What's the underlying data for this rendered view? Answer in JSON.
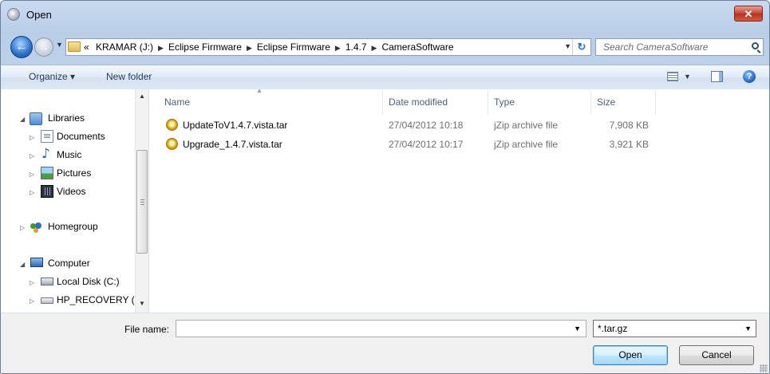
{
  "window": {
    "title": "Open"
  },
  "navigation": {
    "address_root": "KRAMAR (J:)",
    "breadcrumbs": [
      "KRAMAR (J:)",
      "Eclipse Firmware",
      "Eclipse Firmware",
      "1.4.7",
      "CameraSoftware"
    ],
    "overflow_chevron": "«",
    "search_placeholder": "Search CameraSoftware"
  },
  "toolbar": {
    "organize_label": "Organize ▾",
    "new_folder_label": "New folder"
  },
  "sidebar": {
    "items": [
      {
        "label": "Libraries",
        "icon": "libraries-icon",
        "expanded": true
      },
      {
        "label": "Documents",
        "icon": "documents-icon"
      },
      {
        "label": "Music",
        "icon": "music-icon"
      },
      {
        "label": "Pictures",
        "icon": "pictures-icon"
      },
      {
        "label": "Videos",
        "icon": "videos-icon"
      },
      {
        "label": "Homegroup",
        "icon": "homegroup-icon"
      },
      {
        "label": "Computer",
        "icon": "computer-icon",
        "expanded": true
      },
      {
        "label": "Local Disk (C:)",
        "icon": "local-disk-icon"
      },
      {
        "label": "HP_RECOVERY (I",
        "icon": "drive-icon"
      }
    ]
  },
  "columns": [
    "Name",
    "Date modified",
    "Type",
    "Size"
  ],
  "files": [
    {
      "name": "UpdateToV1.4.7.vista.tar",
      "date": "27/04/2012 10:18",
      "type": "jZip archive file",
      "size": "7,908 KB"
    },
    {
      "name": "Upgrade_1.4.7.vista.tar",
      "date": "27/04/2012 10:17",
      "type": "jZip archive file",
      "size": "3,921 KB"
    }
  ],
  "footer": {
    "file_name_label": "File name:",
    "file_name_value": "",
    "filter_selected": "*.tar.gz",
    "open_label": "Open",
    "cancel_label": "Cancel"
  }
}
